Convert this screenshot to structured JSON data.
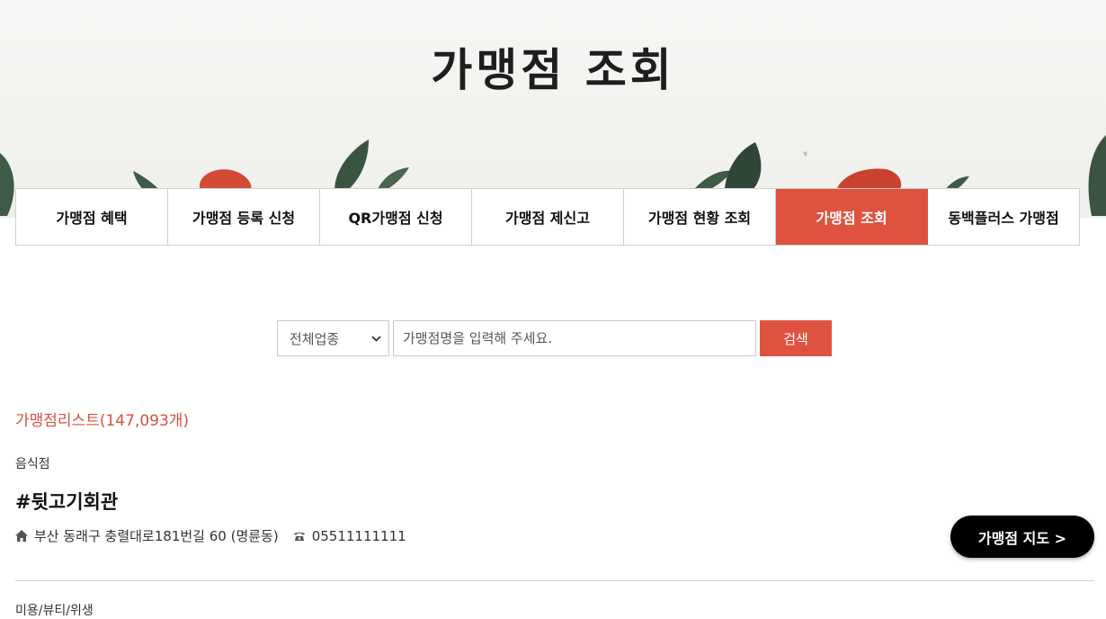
{
  "header": {
    "title": "가맹점 조회"
  },
  "tabs": [
    {
      "label": "가맹점 혜택",
      "active": false
    },
    {
      "label": "가맹점 등록 신청",
      "active": false
    },
    {
      "label": "QR가맹점 신청",
      "active": false
    },
    {
      "label": "가맹점 제신고",
      "active": false
    },
    {
      "label": "가맹점 현황 조회",
      "active": false
    },
    {
      "label": "가맹점 조회",
      "active": true
    },
    {
      "label": "동백플러스 가맹점",
      "active": false
    }
  ],
  "search": {
    "category_selected": "전체업종",
    "placeholder": "가맹점명을 입력해 주세요.",
    "button_label": "검색"
  },
  "list": {
    "count_label": "가맹점리스트(147,093개)",
    "items": [
      {
        "category": "음식점",
        "name": "#뒷고기회관",
        "address": "부산 동래구 충렬대로181번길 60 (명륜동)",
        "phone": "05511111111"
      }
    ],
    "next_category": "미용/뷰티/위생"
  },
  "map_button": {
    "label": "가맹점 지도 >"
  },
  "colors": {
    "accent": "#e05240",
    "map_button": "#000000"
  },
  "icons": {
    "address": "home-icon",
    "phone": "phone-icon"
  }
}
